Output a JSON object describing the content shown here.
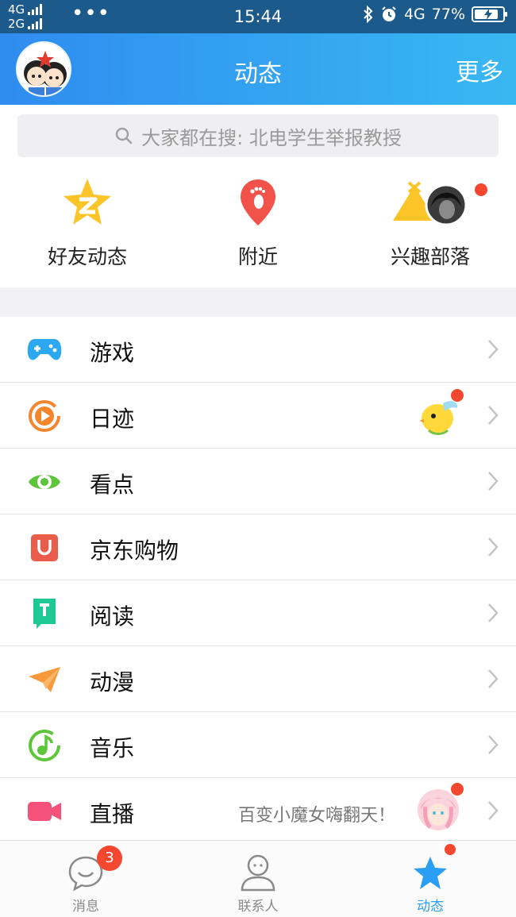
{
  "status_bar": {
    "network_top": "4G",
    "network_bottom": "2G",
    "dots": "•••",
    "time": "15:44",
    "net_right": "4G",
    "battery": "77%",
    "battery_level": 0.77
  },
  "header": {
    "title": "动态",
    "more_label": "更多"
  },
  "search": {
    "placeholder": "大家都在搜: 北电学生举报教授"
  },
  "quick": [
    {
      "label": "好友动态",
      "icon": "qzone-star-icon"
    },
    {
      "label": "附近",
      "icon": "location-footprint-icon"
    },
    {
      "label": "兴趣部落",
      "icon": "tent-icon"
    }
  ],
  "list": [
    {
      "label": "游戏",
      "icon": "gamepad-icon",
      "color": "#2ca8f0"
    },
    {
      "label": "日迹",
      "icon": "play-circle-icon",
      "color": "#f5862c"
    },
    {
      "label": "看点",
      "icon": "eye-icon",
      "color": "#5cc53a"
    },
    {
      "label": "京东购物",
      "icon": "shopping-bag-icon",
      "color": "#ea5d4b"
    },
    {
      "label": "阅读",
      "icon": "book-icon",
      "color": "#1fc995"
    },
    {
      "label": "动漫",
      "icon": "paper-plane-icon",
      "color": "#f89a3c"
    },
    {
      "label": "音乐",
      "icon": "music-note-icon",
      "color": "#5cc53a"
    },
    {
      "label": "直播",
      "icon": "video-camera-icon",
      "color": "#f4527a",
      "desc": "百变小魔女嗨翻天！"
    }
  ],
  "tabs": [
    {
      "label": "消息",
      "badge": "3"
    },
    {
      "label": "联系人"
    },
    {
      "label": "动态"
    }
  ],
  "colors": {
    "header_start": "#2f8cf0",
    "header_end": "#38b8f2",
    "active_tab": "#2a9df4",
    "badge_red": "#f3472f"
  }
}
